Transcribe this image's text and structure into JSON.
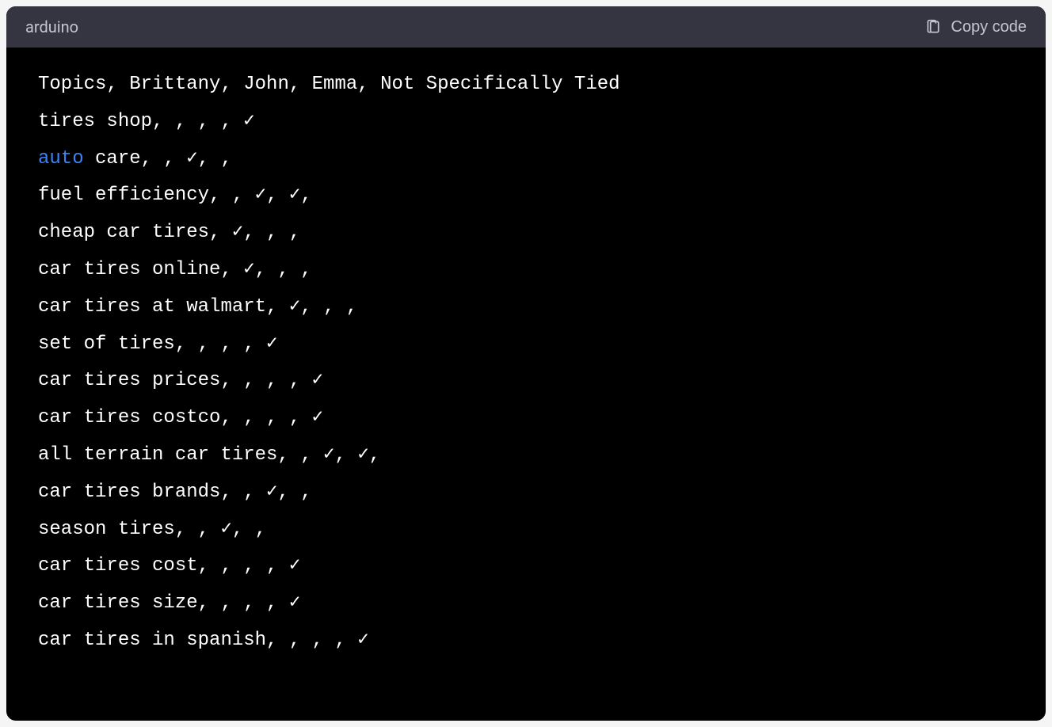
{
  "header": {
    "language": "arduino",
    "copy_label": "Copy code"
  },
  "code": {
    "lines": [
      {
        "segments": [
          {
            "text": "Topics, Brittany, John, Emma, Not Specifically Tied",
            "class": ""
          }
        ]
      },
      {
        "segments": [
          {
            "text": "tires shop, , , , ✓",
            "class": ""
          }
        ]
      },
      {
        "segments": [
          {
            "text": "auto",
            "class": "keyword"
          },
          {
            "text": " care, , ✓, , ",
            "class": ""
          }
        ]
      },
      {
        "segments": [
          {
            "text": "fuel efficiency, , ✓, ✓, ",
            "class": ""
          }
        ]
      },
      {
        "segments": [
          {
            "text": "cheap car tires, ✓, , , ",
            "class": ""
          }
        ]
      },
      {
        "segments": [
          {
            "text": "car tires online, ✓, , , ",
            "class": ""
          }
        ]
      },
      {
        "segments": [
          {
            "text": "car tires at walmart, ✓, , , ",
            "class": ""
          }
        ]
      },
      {
        "segments": [
          {
            "text": "set of tires, , , , ✓",
            "class": ""
          }
        ]
      },
      {
        "segments": [
          {
            "text": "car tires prices, , , , ✓",
            "class": ""
          }
        ]
      },
      {
        "segments": [
          {
            "text": "car tires costco, , , , ✓",
            "class": ""
          }
        ]
      },
      {
        "segments": [
          {
            "text": "all terrain car tires, , ✓, ✓, ",
            "class": ""
          }
        ]
      },
      {
        "segments": [
          {
            "text": "car tires brands, , ✓, , ",
            "class": ""
          }
        ]
      },
      {
        "segments": [
          {
            "text": "season tires, , ✓, , ",
            "class": ""
          }
        ]
      },
      {
        "segments": [
          {
            "text": "car tires cost, , , , ✓",
            "class": ""
          }
        ]
      },
      {
        "segments": [
          {
            "text": "car tires size, , , , ✓",
            "class": ""
          }
        ]
      },
      {
        "segments": [
          {
            "text": "car tires in spanish, , , , ✓",
            "class": ""
          }
        ]
      }
    ]
  }
}
